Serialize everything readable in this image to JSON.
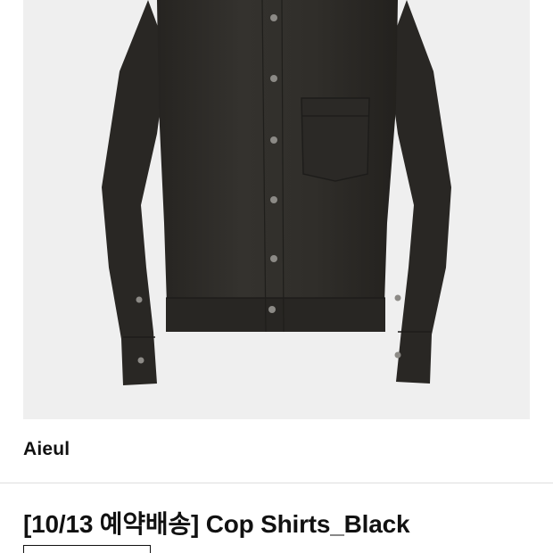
{
  "product": {
    "brand": "Aieul",
    "title": "[10/13 예약배송] Cop Shirts_Black"
  },
  "colors": {
    "image_background": "#efefef",
    "shirt": "#2e2c29",
    "text": "#111111",
    "divider": "#dedede"
  }
}
